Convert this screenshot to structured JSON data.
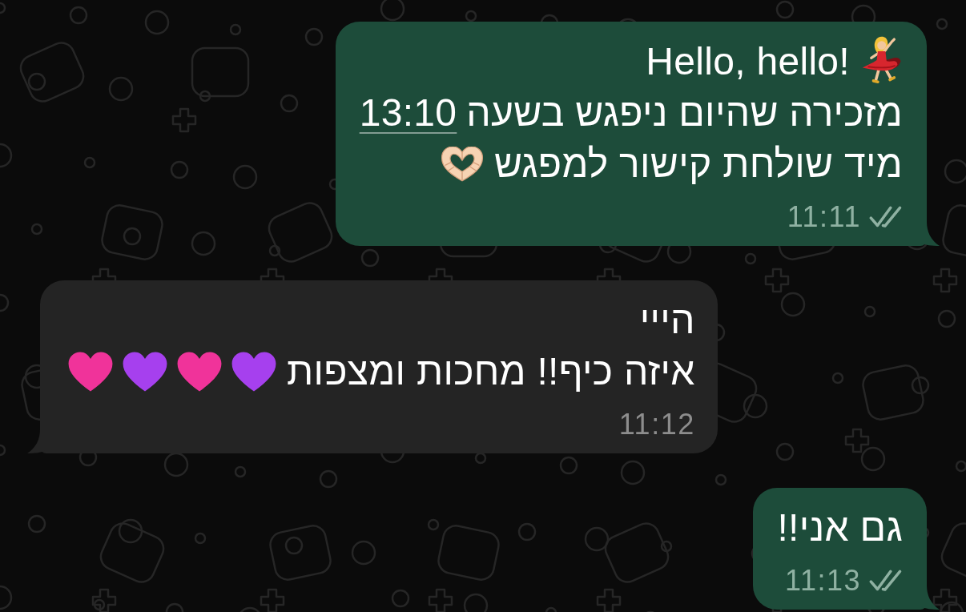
{
  "messages": [
    {
      "kind": "outgoing",
      "read": false,
      "time": "11:11",
      "lines": [
        {
          "segments": [
            {
              "kind": "text",
              "text": "Hello, hello!"
            },
            {
              "kind": "dancer"
            }
          ]
        },
        {
          "segments": [
            {
              "kind": "text",
              "text": "מזכירה שהיום ניפגש בשעה"
            },
            {
              "kind": "link",
              "text": "13:10"
            }
          ]
        },
        {
          "segments": [
            {
              "kind": "text",
              "text": "מיד שולחת קישור למפגש"
            },
            {
              "kind": "hands"
            }
          ]
        }
      ]
    },
    {
      "kind": "incoming",
      "time": "11:12",
      "lines": [
        {
          "segments": [
            {
              "kind": "text",
              "text": "הייי"
            }
          ]
        },
        {
          "segments": [
            {
              "kind": "text",
              "text": "איזה כיף!! מחכות ומצפות"
            },
            {
              "kind": "heart",
              "color": "#a640ee"
            },
            {
              "kind": "heart",
              "color": "#f0339a"
            },
            {
              "kind": "heart",
              "color": "#a640ee"
            },
            {
              "kind": "heart",
              "color": "#f0339a"
            }
          ]
        }
      ]
    },
    {
      "kind": "outgoing",
      "read": false,
      "time": "11:13",
      "lines": [
        {
          "segments": [
            {
              "kind": "text",
              "text": "גם אני!!"
            }
          ]
        }
      ]
    }
  ]
}
